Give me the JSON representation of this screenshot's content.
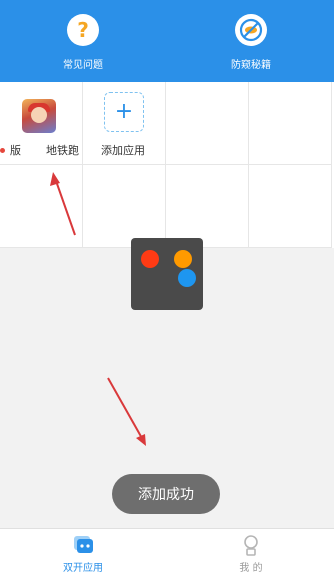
{
  "header": {
    "faq": {
      "label": "常见问题",
      "icon": "question-icon"
    },
    "anti_theft": {
      "label": "防窥秘籍",
      "icon": "no-peeking-icon"
    }
  },
  "apps": [
    {
      "label": "版",
      "badge": "red-dot"
    },
    {
      "label": "地铁跑",
      "icon": "subway-surfers-app-icon"
    },
    {
      "label": "添加应用",
      "icon": "plus-icon"
    }
  ],
  "toast": {
    "text": "添加成功"
  },
  "loading": {
    "colors": [
      "#ff3b14",
      "#ff9a00",
      "#1e96f0"
    ]
  },
  "tabbar": {
    "dual_apps": {
      "label": "双开应用",
      "active": true,
      "icon": "dual-apps-icon"
    },
    "me": {
      "label": "我 的",
      "active": false,
      "icon": "profile-icon"
    }
  },
  "colors": {
    "primary": "#2b90e8",
    "arrow": "#d9393b",
    "background": "#f2f2f2"
  }
}
